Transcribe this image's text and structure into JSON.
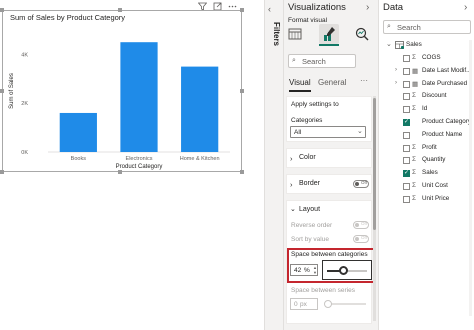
{
  "report": {
    "chart_title": "Sum of Sales by Product Category",
    "filters_label": "Filters"
  },
  "chart_data": {
    "type": "bar",
    "title": "Sum of Sales by Product Category",
    "xlabel": "Product Category",
    "ylabel": "Sum of Sales",
    "categories": [
      "Books",
      "Electronics",
      "Home & Kitchen"
    ],
    "values": [
      1.6,
      4.5,
      3.5
    ],
    "ylim": [
      0,
      5
    ],
    "yticks": [
      "0K",
      "2K",
      "4K"
    ],
    "ytick_values": [
      0,
      2,
      4
    ],
    "grid": false,
    "bar_color": "#1f8be8"
  },
  "visualizations": {
    "title": "Visualizations",
    "format_label": "Format visual",
    "search_placeholder": "Search",
    "tabs": [
      "Visual",
      "General"
    ],
    "more": "···",
    "apply_settings": "Apply settings to",
    "categories_label": "Categories",
    "categories_value": "All",
    "sections": {
      "color": "Color",
      "border": "Border",
      "layout": "Layout"
    },
    "border_toggle": "Off",
    "reverse_order": "Reverse order",
    "reverse_toggle": "Off",
    "sort_by_value": "Sort by value",
    "sort_toggle": "Off",
    "space_between_categories": "Space between categories",
    "space_value": "42",
    "space_unit": "%",
    "space_fraction": 0.42,
    "space_between_series": "Space between series",
    "series_value": "0",
    "series_unit": "px"
  },
  "data": {
    "title": "Data",
    "search_placeholder": "Search",
    "table": "Sales",
    "fields": [
      {
        "name": "COGS",
        "icon": "sum-icon",
        "checked": false,
        "expand": false
      },
      {
        "name": "Date Last Modif...",
        "icon": "calendar-icon",
        "checked": false,
        "expand": true
      },
      {
        "name": "Date Purchased",
        "icon": "calendar-icon",
        "checked": false,
        "expand": true
      },
      {
        "name": "Discount",
        "icon": "sum-icon",
        "checked": false,
        "expand": false
      },
      {
        "name": "Id",
        "icon": "sum-icon",
        "checked": false,
        "expand": false
      },
      {
        "name": "Product Category",
        "icon": "",
        "checked": true,
        "expand": false
      },
      {
        "name": "Product Name",
        "icon": "",
        "checked": false,
        "expand": false
      },
      {
        "name": "Profit",
        "icon": "sum-icon",
        "checked": false,
        "expand": false
      },
      {
        "name": "Quantity",
        "icon": "sum-icon",
        "checked": false,
        "expand": false
      },
      {
        "name": "Sales",
        "icon": "sum-icon",
        "checked": true,
        "expand": false
      },
      {
        "name": "Unit Cost",
        "icon": "sum-icon",
        "checked": false,
        "expand": false
      },
      {
        "name": "Unit Price",
        "icon": "sum-icon",
        "checked": false,
        "expand": false
      }
    ]
  },
  "colors": {
    "accent": "#117865",
    "highlight": "#c4262e",
    "bar": "#1f8be8"
  }
}
